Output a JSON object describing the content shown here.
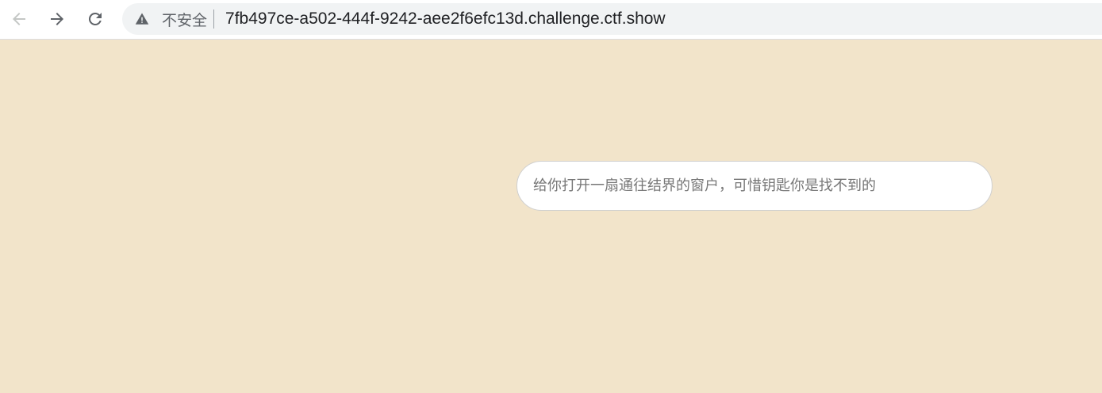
{
  "browser": {
    "security_label": "不安全",
    "url": "7fb497ce-a502-444f-9242-aee2f6efc13d.challenge.ctf.show",
    "icons": {
      "back": "back-arrow-icon",
      "forward": "forward-arrow-icon",
      "reload": "reload-icon",
      "warning": "warning-icon"
    }
  },
  "page": {
    "background_color": "#f2e4ca",
    "input": {
      "placeholder": "给你打开一扇通往结界的窗户，可惜钥匙你是找不到的",
      "value": ""
    }
  }
}
